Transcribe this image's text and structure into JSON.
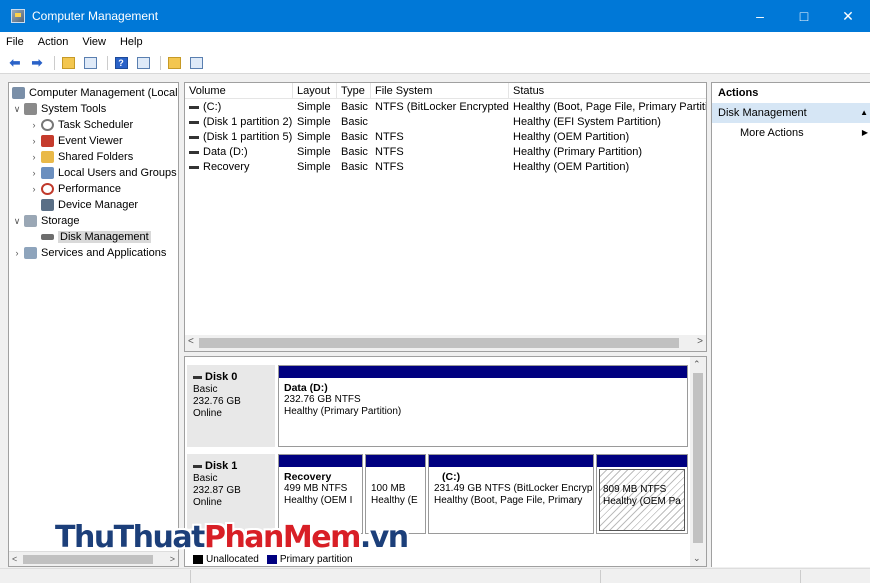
{
  "window": {
    "title": "Computer Management",
    "accent": "#0078d7"
  },
  "menu": [
    "File",
    "Action",
    "View",
    "Help"
  ],
  "tree": {
    "items": [
      {
        "label": "Computer Management (Local",
        "level": 0,
        "exp": "",
        "icon": "computer-icon"
      },
      {
        "label": "System Tools",
        "level": 1,
        "exp": "∨",
        "icon": "tools-icon"
      },
      {
        "label": "Task Scheduler",
        "level": 2,
        "exp": ">",
        "icon": "clock-icon"
      },
      {
        "label": "Event Viewer",
        "level": 2,
        "exp": ">",
        "icon": "event-viewer-icon"
      },
      {
        "label": "Shared Folders",
        "level": 2,
        "exp": ">",
        "icon": "shared-folder-icon"
      },
      {
        "label": "Local Users and Groups",
        "level": 2,
        "exp": ">",
        "icon": "users-icon"
      },
      {
        "label": "Performance",
        "level": 2,
        "exp": ">",
        "icon": "performance-icon"
      },
      {
        "label": "Device Manager",
        "level": 2,
        "exp": "",
        "icon": "device-manager-icon"
      },
      {
        "label": "Storage",
        "level": 1,
        "exp": "∨",
        "icon": "storage-icon"
      },
      {
        "label": "Disk Management",
        "level": 2,
        "exp": "",
        "icon": "disk-icon",
        "selected": true
      },
      {
        "label": "Services and Applications",
        "level": 1,
        "exp": ">",
        "icon": "services-icon"
      }
    ]
  },
  "volumes": {
    "columns": [
      "Volume",
      "Layout",
      "Type",
      "File System",
      "Status"
    ],
    "rows": [
      [
        "(C:)",
        "Simple",
        "Basic",
        "NTFS (BitLocker Encrypted)",
        "Healthy (Boot, Page File, Primary Partitio"
      ],
      [
        "(Disk 1 partition 2)",
        "Simple",
        "Basic",
        "",
        "Healthy (EFI System Partition)"
      ],
      [
        "(Disk 1 partition 5)",
        "Simple",
        "Basic",
        "NTFS",
        "Healthy (OEM Partition)"
      ],
      [
        "Data (D:)",
        "Simple",
        "Basic",
        "NTFS",
        "Healthy (Primary Partition)"
      ],
      [
        "Recovery",
        "Simple",
        "Basic",
        "NTFS",
        "Healthy (OEM Partition)"
      ]
    ]
  },
  "disks": {
    "disk0": {
      "name": "Disk 0",
      "type": "Basic",
      "size": "232.76 GB",
      "state": "Online",
      "partitions": [
        {
          "name": "Data  (D:)",
          "size": "232.76 GB NTFS",
          "status": "Healthy (Primary Partition)"
        }
      ]
    },
    "disk1": {
      "name": "Disk 1",
      "type": "Basic",
      "size": "232.87 GB",
      "state": "Online",
      "partitions": [
        {
          "name": "Recovery",
          "size": "499 MB NTFS",
          "status": "Healthy (OEM I"
        },
        {
          "name": "",
          "size": "100 MB",
          "status": "Healthy (E"
        },
        {
          "name": "(C:)",
          "size": "231.49 GB NTFS (BitLocker Encryp",
          "status": "Healthy (Boot, Page File, Primary"
        },
        {
          "name": "",
          "size": "809 MB NTFS",
          "status": "Healthy (OEM Pa"
        }
      ]
    },
    "legend": [
      "Unallocated",
      "Primary partition"
    ],
    "partition_color": "#000080"
  },
  "actions": {
    "header": "Actions",
    "section": "Disk Management",
    "items": [
      "More Actions"
    ]
  },
  "watermark": {
    "part1": "ThuThuat",
    "part2": "PhanMem",
    "part3": ".vn"
  }
}
